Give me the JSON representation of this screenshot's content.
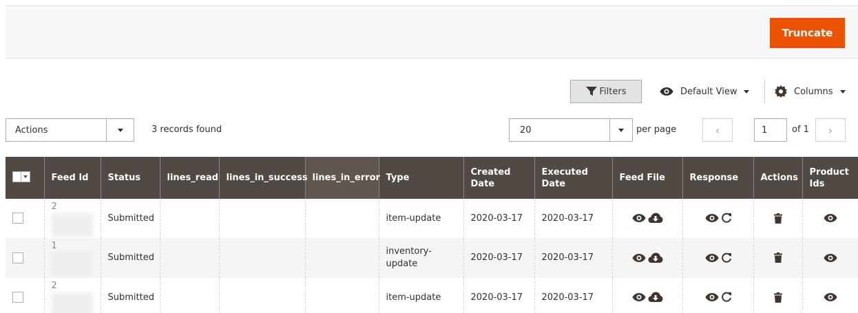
{
  "header": {
    "truncate_label": "Truncate"
  },
  "toolbar": {
    "filters_label": "Filters",
    "view_label": "Default View",
    "columns_label": "Columns",
    "actions_label": "Actions",
    "records_found": "3 records found",
    "per_page_value": "20",
    "per_page_label": "per page",
    "current_page": "1",
    "page_of": "of 1"
  },
  "grid": {
    "columns": [
      "Feed Id",
      "Status",
      "lines_read",
      "lines_in_success",
      "lines_in_error",
      "Type",
      "Created Date",
      "Executed Date",
      "Feed File",
      "Response",
      "Actions",
      "Product Ids"
    ],
    "rows": [
      {
        "id_prefix": "2",
        "status": "Submitted",
        "type": "item-update",
        "created": "2020-03-17",
        "executed": "2020-03-17"
      },
      {
        "id_prefix": "1",
        "status": "Submitted",
        "type": "inventory-update",
        "created": "2020-03-17",
        "executed": "2020-03-17"
      },
      {
        "id_prefix": "2",
        "status": "Submitted",
        "type": "item-update",
        "created": "2020-03-17",
        "executed": "2020-03-17"
      }
    ]
  },
  "colors": {
    "accent": "#eb5202",
    "header_bg": "#514943",
    "icon": "#41362f"
  },
  "icons": [
    "filter-icon",
    "eye-icon",
    "gear-icon",
    "cloud-download-icon",
    "refresh-icon",
    "trash-icon"
  ]
}
